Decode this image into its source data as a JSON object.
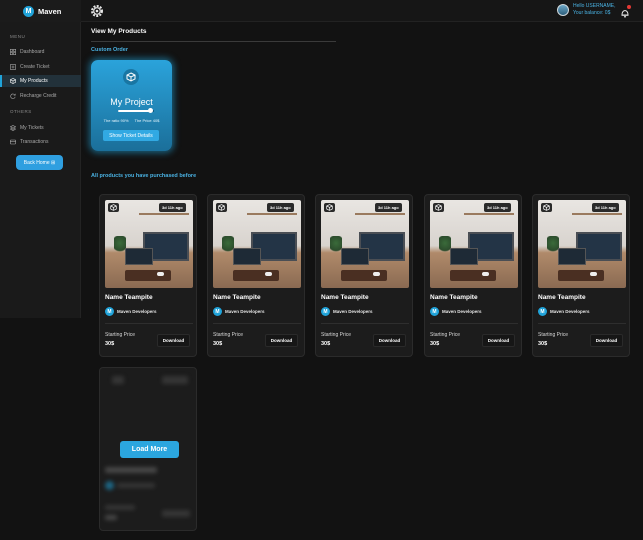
{
  "brand": {
    "initial": "M",
    "name": "Maven"
  },
  "header": {
    "greeting": "Hello USERNAME,",
    "balance": "Your balance: 0$"
  },
  "sidebar": {
    "menu_heading": "MENU",
    "others_heading": "OTHERS",
    "items": [
      {
        "label": "Dashboard",
        "icon": "grid-icon"
      },
      {
        "label": "Create Ticket",
        "icon": "plus-square-icon"
      },
      {
        "label": "My Products",
        "icon": "cube-icon",
        "active": true
      },
      {
        "label": "Recharge Credit",
        "icon": "refresh-icon"
      },
      {
        "label": "My Tickets",
        "icon": "stack-icon"
      },
      {
        "label": "Transactions",
        "icon": "card-icon"
      }
    ],
    "back_button": "Back Home ⊞"
  },
  "main": {
    "title": "View My Products",
    "custom_section": "Custom Order",
    "purchased_section": "All products you have purchased before"
  },
  "project": {
    "title": "My Project",
    "ratio_text": "The ratio 90%",
    "price_text": "The Price 40$",
    "progress": 0.9,
    "button": "Show Ticket Details"
  },
  "products": [
    {
      "time": "3d 11h ago",
      "name": "Name Teampite",
      "developer": "Maven Developers",
      "dev_initial": "M",
      "price_label": "Starting Price",
      "price": "30$",
      "download": "Download"
    },
    {
      "time": "3d 11h ago",
      "name": "Name Teampite",
      "developer": "Maven Developers",
      "dev_initial": "M",
      "price_label": "Starting Price",
      "price": "30$",
      "download": "Download"
    },
    {
      "time": "3d 11h ago",
      "name": "Name Teampite",
      "developer": "Maven Developers",
      "dev_initial": "M",
      "price_label": "Starting Price",
      "price": "30$",
      "download": "Download"
    },
    {
      "time": "3d 11h ago",
      "name": "Name Teampite",
      "developer": "Maven Developers",
      "dev_initial": "M",
      "price_label": "Starting Price",
      "price": "30$",
      "download": "Download"
    },
    {
      "time": "3d 11h ago",
      "name": "Name Teampite",
      "developer": "Maven Developers",
      "dev_initial": "M",
      "price_label": "Starting Price",
      "price": "30$",
      "download": "Download"
    }
  ],
  "load_more": "Load More",
  "colors": {
    "accent": "#20a3d9",
    "background": "#121212",
    "sidebar": "#1a1a1a",
    "card": "#1c1c1c",
    "link": "#4ab2e3"
  }
}
